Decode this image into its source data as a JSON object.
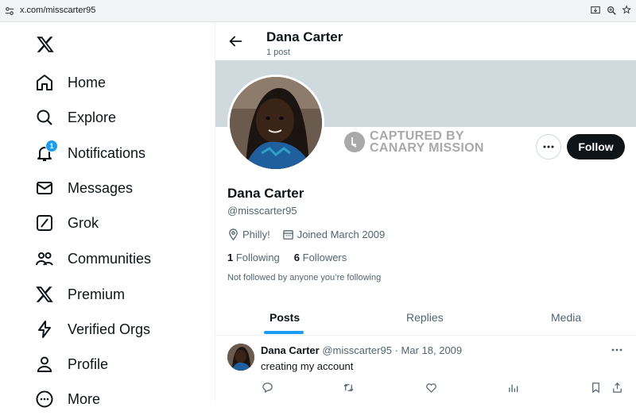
{
  "browser": {
    "url": "x.com/misscarter95",
    "icons": [
      "site-info-icon",
      "install-app-icon",
      "zoom-icon",
      "bookmark-star-icon"
    ]
  },
  "nav": {
    "items": [
      {
        "label": "Home",
        "icon": "home-icon"
      },
      {
        "label": "Explore",
        "icon": "search-icon"
      },
      {
        "label": "Notifications",
        "icon": "bell-icon",
        "badge": "1"
      },
      {
        "label": "Messages",
        "icon": "mail-icon"
      },
      {
        "label": "Grok",
        "icon": "grok-icon"
      },
      {
        "label": "Communities",
        "icon": "communities-icon"
      },
      {
        "label": "Premium",
        "icon": "x-logo-icon"
      },
      {
        "label": "Verified Orgs",
        "icon": "lightning-icon"
      },
      {
        "label": "Profile",
        "icon": "person-icon"
      },
      {
        "label": "More",
        "icon": "more-circle-icon"
      }
    ]
  },
  "header": {
    "name": "Dana Carter",
    "post_count": "1 post"
  },
  "watermark": {
    "line1": "CAPTURED BY",
    "line2": "CANARY MISSION"
  },
  "profile": {
    "follow_label": "Follow",
    "name": "Dana Carter",
    "handle": "@misscarter95",
    "location": "Philly!",
    "joined": "Joined March 2009",
    "following_count": "1",
    "following_label": "Following",
    "followers_count": "6",
    "followers_label": "Followers",
    "followed_note": "Not followed by anyone you’re following"
  },
  "tabs": [
    {
      "label": "Posts",
      "active": true
    },
    {
      "label": "Replies",
      "active": false
    },
    {
      "label": "Media",
      "active": false
    }
  ],
  "tweet": {
    "name": "Dana Carter",
    "handle": "@misscarter95",
    "separator": "·",
    "date": "Mar 18, 2009",
    "text": "creating my account"
  },
  "colors": {
    "accent": "#1d9bf0",
    "banner": "#cfd9de",
    "follow_button": "#0f1419",
    "secondary_text": "#536471"
  }
}
